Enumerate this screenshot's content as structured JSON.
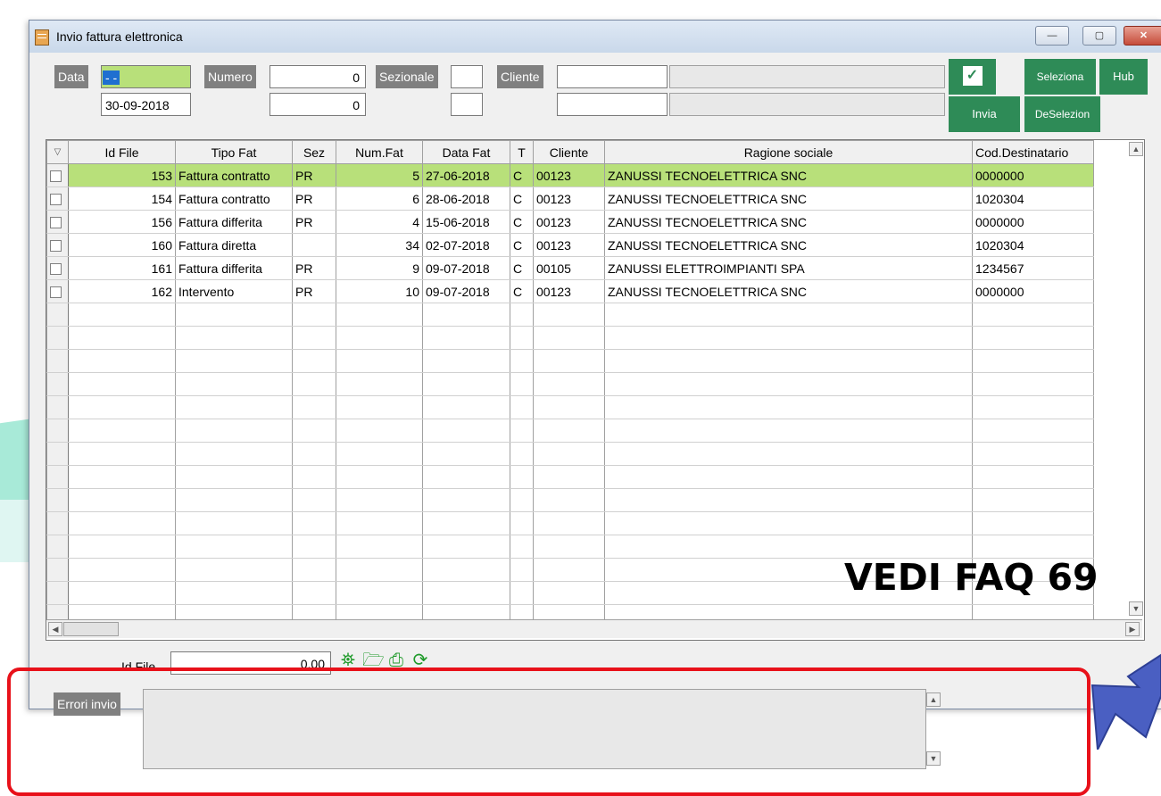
{
  "window": {
    "title": "Invio fattura elettronica",
    "controls": {
      "minimize": "—",
      "maximize": "▢",
      "close": "✕"
    }
  },
  "filters": {
    "data_label": "Data",
    "data_value": "- -",
    "data_value2": "30-09-2018",
    "numero_label": "Numero",
    "numero_value": "0",
    "numero_value2": "0",
    "sezionale_label": "Sezionale",
    "sezionale_value": "",
    "sezionale_value2": "",
    "cliente_label": "Cliente",
    "cliente_code": "",
    "cliente_code2": "",
    "cliente_name": "",
    "cliente_name2": ""
  },
  "buttons": {
    "check_icon": "check-icon",
    "seleziona": "Seleziona",
    "hub": "Hub",
    "invia": "Invia",
    "deseleziona": "DeSelezion"
  },
  "grid": {
    "columns": [
      "Id File",
      "Tipo Fat",
      "Sez",
      "Num.Fat",
      "Data Fat",
      "T",
      "Cliente",
      "Ragione sociale",
      "Cod.Destinatario"
    ],
    "rows": [
      [
        "153",
        "Fattura contratto",
        "PR",
        "5",
        "27-06-2018",
        "C",
        "00123",
        "ZANUSSI TECNOELETTRICA SNC",
        "0000000"
      ],
      [
        "154",
        "Fattura contratto",
        "PR",
        "6",
        "28-06-2018",
        "C",
        "00123",
        "ZANUSSI TECNOELETTRICA SNC",
        "1020304"
      ],
      [
        "156",
        "Fattura differita",
        "PR",
        "4",
        "15-06-2018",
        "C",
        "00123",
        "ZANUSSI TECNOELETTRICA SNC",
        "0000000"
      ],
      [
        "160",
        "Fattura diretta",
        "",
        "34",
        "02-07-2018",
        "C",
        "00123",
        "ZANUSSI TECNOELETTRICA SNC",
        "1020304"
      ],
      [
        "161",
        "Fattura differita",
        "PR",
        "9",
        "09-07-2018",
        "C",
        "00105",
        "ZANUSSI ELETTROIMPIANTI SPA",
        "1234567"
      ],
      [
        "162",
        "Intervento",
        "PR",
        "10",
        "09-07-2018",
        "C",
        "00123",
        "ZANUSSI TECNOELETTRICA SNC",
        "0000000"
      ]
    ],
    "highlight_color": "#b8e07a"
  },
  "bottom": {
    "id_file_label": "Id File",
    "id_file_value": "0.00",
    "errori_label": "Errori invio",
    "errori_value": ""
  },
  "annotation": {
    "faq_text": "VEDI FAQ 69"
  },
  "colors": {
    "accent_green": "#2e8b57",
    "label_gray": "#808080",
    "annotation_red": "#e8111a",
    "arrow_blue": "#4a5fc2"
  }
}
